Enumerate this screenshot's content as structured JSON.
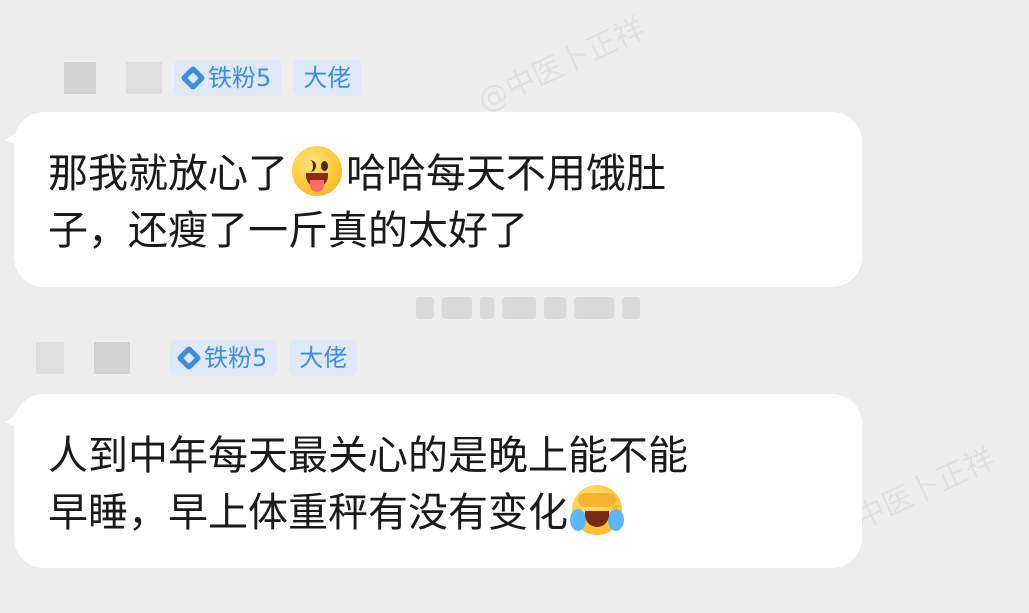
{
  "watermark": "@中医卜正祥",
  "messages": [
    {
      "badges": {
        "fan_level": "铁粉5",
        "title": "大佬"
      },
      "text_a": "那我就放心了",
      "text_b": "哈哈每天不用饿肚",
      "text_c": "子，还瘦了一斤真的太好了",
      "emoji": "tongue-wink-emoji-icon"
    },
    {
      "badges": {
        "fan_level": "铁粉5",
        "title": "大佬"
      },
      "text_a": "人到中年每天最关心的是晚上能不能",
      "text_b": "早睡，早上体重秤有没有变化",
      "emoji": "laughing-crying-emoji-icon"
    }
  ],
  "colors": {
    "background": "#ededed",
    "bubble": "#ffffff",
    "badge_bg": "#dfe9f6",
    "badge_text": "#3e8ee0"
  }
}
